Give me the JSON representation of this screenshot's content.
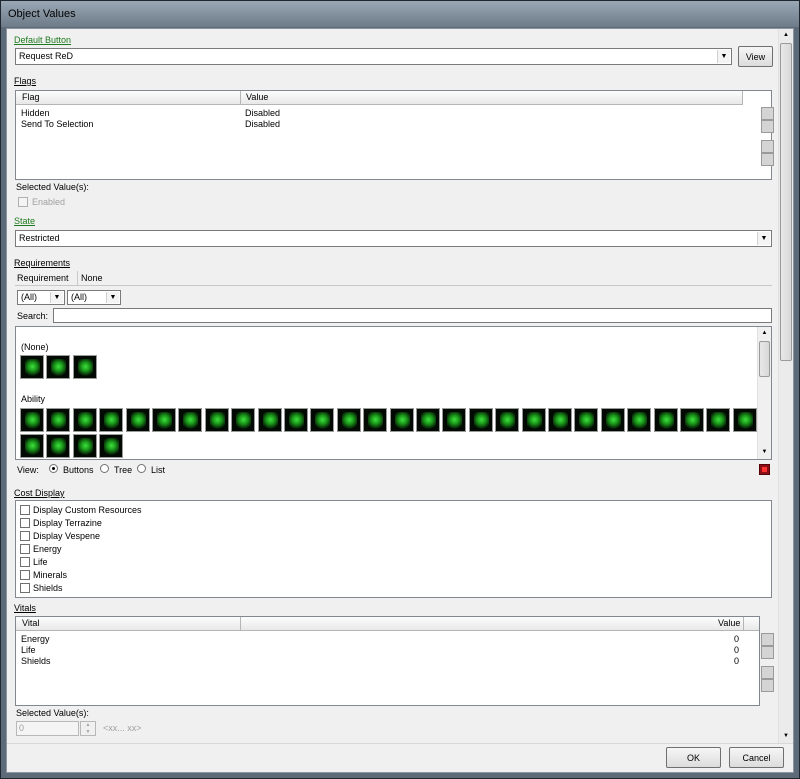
{
  "window": {
    "title": "Object Values"
  },
  "default_button": {
    "label": "Default Button",
    "value": "Request ReD",
    "view_label": "View"
  },
  "flags": {
    "label": "Flags",
    "columns": [
      "Flag",
      "Value"
    ],
    "rows": [
      {
        "flag": "Hidden",
        "value": "Disabled"
      },
      {
        "flag": "Send To Selection",
        "value": "Disabled"
      }
    ],
    "selected_label": "Selected Value(s):",
    "enabled_label": "Enabled"
  },
  "state": {
    "label": "State",
    "value": "Restricted"
  },
  "requirements": {
    "label": "Requirements",
    "requirement_label": "Requirement",
    "requirement_value": "None",
    "filter1": "(All)",
    "filter2": "(All)",
    "search_label": "Search:",
    "search_value": "",
    "groups": [
      {
        "label": "(None)",
        "icon_count": 3
      },
      {
        "label": "Ability",
        "icon_count": 32
      }
    ],
    "view_label": "View:",
    "view_options": [
      "Buttons",
      "Tree",
      "List"
    ],
    "view_selected": "Buttons"
  },
  "cost_display": {
    "label": "Cost Display",
    "items": [
      "Display Custom Resources",
      "Display Terrazine",
      "Display Vespene",
      "Energy",
      "Life",
      "Minerals",
      "Shields"
    ]
  },
  "vitals": {
    "label": "Vitals",
    "columns": [
      "Vital",
      "Value"
    ],
    "rows": [
      {
        "vital": "Energy",
        "value": "0"
      },
      {
        "vital": "Life",
        "value": "0"
      },
      {
        "vital": "Shields",
        "value": "0"
      }
    ],
    "selected_label": "Selected Value(s):",
    "spin_value": "0",
    "range_hint": "<xx... xx>"
  },
  "footer": {
    "ok_label": "OK",
    "cancel_label": "Cancel"
  },
  "colors": {
    "link_green": "#1e7a1e",
    "close_red": "#c8202a"
  }
}
